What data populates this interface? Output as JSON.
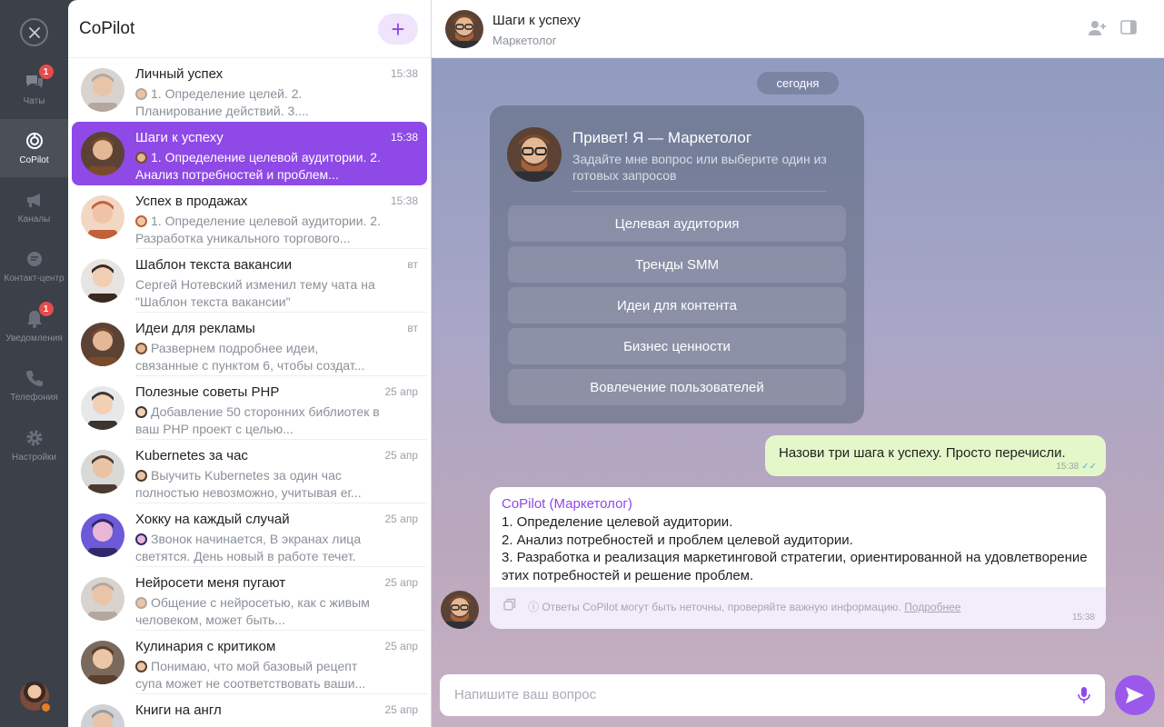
{
  "rail": {
    "close_icon": "close-icon",
    "items": [
      {
        "label": "Чаты",
        "icon": "chats-icon",
        "badge": "1"
      },
      {
        "label": "CoPilot",
        "icon": "copilot-icon",
        "badge": null
      },
      {
        "label": "Каналы",
        "icon": "megaphone-icon",
        "badge": null
      },
      {
        "label": "Контакт-центр",
        "icon": "contact-center-icon",
        "badge": null
      },
      {
        "label": "Уведомления",
        "icon": "bell-icon",
        "badge": "1"
      },
      {
        "label": "Телефония",
        "icon": "phone-icon",
        "badge": null
      },
      {
        "label": "Настройки",
        "icon": "gear-icon",
        "badge": null
      }
    ]
  },
  "list": {
    "title": "CoPilot",
    "add_label": "+",
    "chats": [
      {
        "name": "Личный успех",
        "time": "15:38",
        "preview": "1. Определение целей. 2. Планирование действий. 3....",
        "mini": true
      },
      {
        "name": "Шаги к успеху",
        "time": "15:38",
        "preview": "1. Определение целевой аудитории. 2. Анализ потребностей и проблем...",
        "mini": true
      },
      {
        "name": "Успех в продажах",
        "time": "15:38",
        "preview": "1. Определение целевой аудитории. 2. Разработка уникального торгового...",
        "mini": true
      },
      {
        "name": "Шаблон текста вакансии",
        "time": "вт",
        "preview": "Сергей Нотевский изменил тему чата на \"Шаблон текста вакансии\"",
        "mini": false
      },
      {
        "name": "Идеи для рекламы",
        "time": "вт",
        "preview": "Развернем подробнее идеи, связанные с пунктом 6, чтобы создат...",
        "mini": true
      },
      {
        "name": "Полезные советы PHP",
        "time": "25 апр",
        "preview": "Добавление 50 сторонних библиотек в ваш PHP проект с целью...",
        "mini": true
      },
      {
        "name": "Kubernetes за час",
        "time": "25 апр",
        "preview": "Выучить Kubernetes за один час полностью невозможно, учитывая ег...",
        "mini": true
      },
      {
        "name": "Хокку на каждый случай",
        "time": "25 апр",
        "preview": "Звонок начинается, В экранах лица светятся. День новый в работе течет.",
        "mini": true
      },
      {
        "name": "Нейросети меня пугают",
        "time": "25 апр",
        "preview": "Общение с нейросетью, как с живым человеком, может быть...",
        "mini": true
      },
      {
        "name": "Кулинария с критиком",
        "time": "25 апр",
        "preview": "Понимаю, что мой базовый рецепт супа может не соответствовать ваши...",
        "mini": true
      },
      {
        "name": "Книги на англ",
        "time": "25 апр",
        "preview": "",
        "mini": false
      }
    ]
  },
  "header": {
    "title": "Шаги к успеху",
    "subtitle": "Маркетолог",
    "add_user_icon": "add-user-icon",
    "panel_icon": "side-panel-icon"
  },
  "conversation": {
    "date_chip": "сегодня",
    "welcome": {
      "title": "Привет! Я — Маркетолог",
      "subtitle": "Задайте мне вопрос или выберите один из готовых запросов",
      "prompts": [
        "Целевая аудитория",
        "Тренды SMM",
        "Идеи для контента",
        "Бизнес ценности",
        "Вовлечение пользователей"
      ]
    },
    "outgoing": {
      "text": "Назови три шага к успеху. Просто перечисли.",
      "time": "15:38"
    },
    "incoming": {
      "author": "CoPilot (Маркетолог)",
      "lines": [
        "1. Определение целевой аудитории.",
        "2. Анализ потребностей и проблем целевой аудитории.",
        "3. Разработка и реализация маркетинговой стратегии, ориентированной на удовлетворение этих потребностей и решение проблем."
      ],
      "disclaimer": "Ответы CoPilot могут быть неточны, проверяйте важную информацию.",
      "more_link": "Подробнее",
      "time": "15:38"
    }
  },
  "composer": {
    "placeholder": "Напишите ваш вопрос"
  },
  "colors": {
    "accent": "#8e49e6",
    "rail_bg": "#3b4049",
    "outgoing_bubble": "#e4f7c8",
    "badge": "#e74c4c"
  }
}
